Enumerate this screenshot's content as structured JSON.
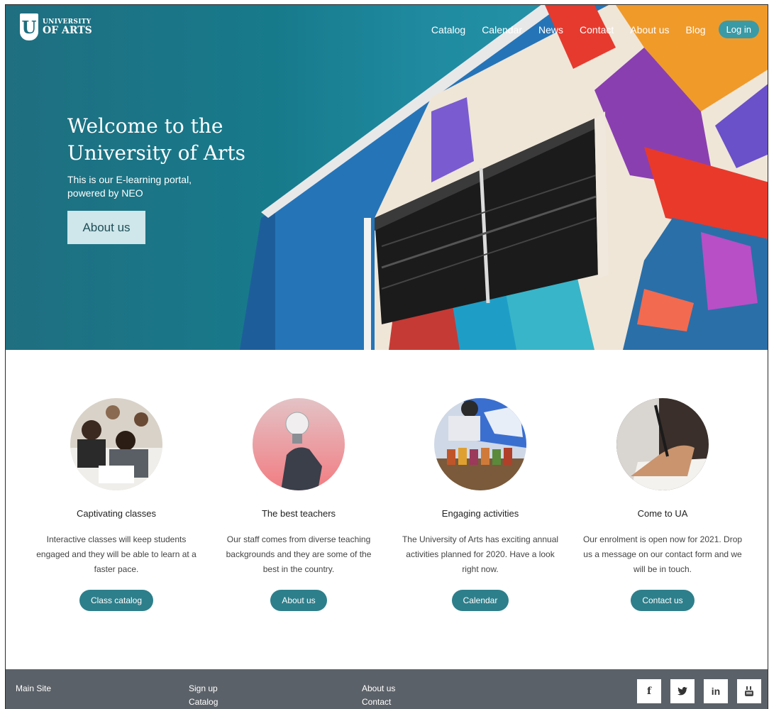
{
  "brand": {
    "line1": "UNIVERSITY",
    "line2": "OF ARTS",
    "mark": "U"
  },
  "nav": {
    "items": [
      "Catalog",
      "Calendar",
      "News",
      "Contact",
      "About us",
      "Blog"
    ],
    "login": "Log in"
  },
  "hero": {
    "title": "Welcome to the University of Arts",
    "subtitle": "This is our E-learning portal, powered by NEO",
    "button": "About us"
  },
  "features": [
    {
      "title": "Captivating classes",
      "desc": "Interactive classes will keep students engaged and they will be able to learn at a faster pace.",
      "button": "Class catalog",
      "icon": "classroom-photo"
    },
    {
      "title": "The best teachers",
      "desc": "Our staff comes from diverse teaching backgrounds and they are some of the best in the country.",
      "button": "About us",
      "icon": "lightbulb-photo"
    },
    {
      "title": "Engaging activities",
      "desc": "The University of Arts has exciting annual activities planned for 2020. Have a look right now.",
      "button": "Calendar",
      "icon": "paint-jars-photo"
    },
    {
      "title": "Come to UA",
      "desc": "Our enrolment is open now for 2021. Drop us a message on our contact form and we will be in touch.",
      "button": "Contact us",
      "icon": "writing-photo"
    }
  ],
  "footer": {
    "col1": [
      "Main Site"
    ],
    "col2": [
      "Sign up",
      "Catalog"
    ],
    "col3": [
      "About us",
      "Contact"
    ],
    "social": [
      "f",
      "twitter",
      "in",
      "youtube"
    ]
  },
  "colors": {
    "accent": "#2d7f8b",
    "footer": "#5b6168",
    "hero": "#1a7f92"
  }
}
